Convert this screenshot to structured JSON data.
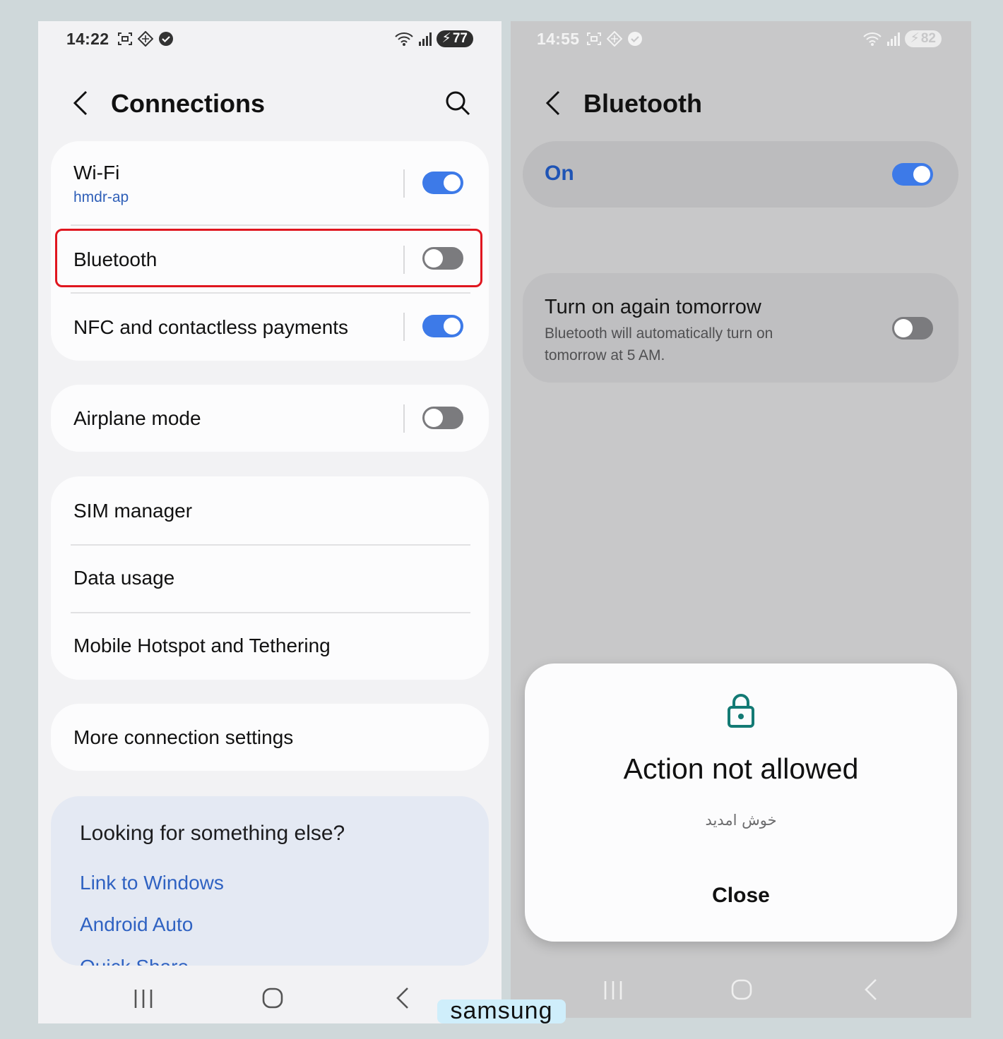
{
  "left": {
    "status": {
      "time": "14:22",
      "battery": "77"
    },
    "title": "Connections",
    "wifi": {
      "label": "Wi-Fi",
      "network": "hmdr-ap",
      "state": "on"
    },
    "bluetooth": {
      "label": "Bluetooth",
      "state": "off"
    },
    "nfc": {
      "label": "NFC and contactless payments",
      "state": "on"
    },
    "airplane": {
      "label": "Airplane mode",
      "state": "off"
    },
    "sim": {
      "label": "SIM manager"
    },
    "data": {
      "label": "Data usage"
    },
    "hotspot": {
      "label": "Mobile Hotspot and Tethering"
    },
    "more": {
      "label": "More connection settings"
    },
    "suggestions": {
      "heading": "Looking for something else?",
      "links": [
        "Link to Windows",
        "Android Auto",
        "Quick Share"
      ]
    }
  },
  "right": {
    "status": {
      "time": "14:55",
      "battery": "82"
    },
    "title": "Bluetooth",
    "master": {
      "label": "On",
      "state": "on"
    },
    "tomorrow": {
      "label": "Turn on again tomorrow",
      "description": "Bluetooth will automatically turn on tomorrow at 5 AM.",
      "state": "off"
    },
    "dialog": {
      "title": "Action not allowed",
      "message": "خوش امدید",
      "close_label": "Close",
      "icon": "lock-icon"
    }
  },
  "watermark": "samsung",
  "colors": {
    "accent": "#3d7ae8",
    "link": "#2f62c2",
    "highlight": "#e0161f",
    "lock": "#137a74"
  }
}
